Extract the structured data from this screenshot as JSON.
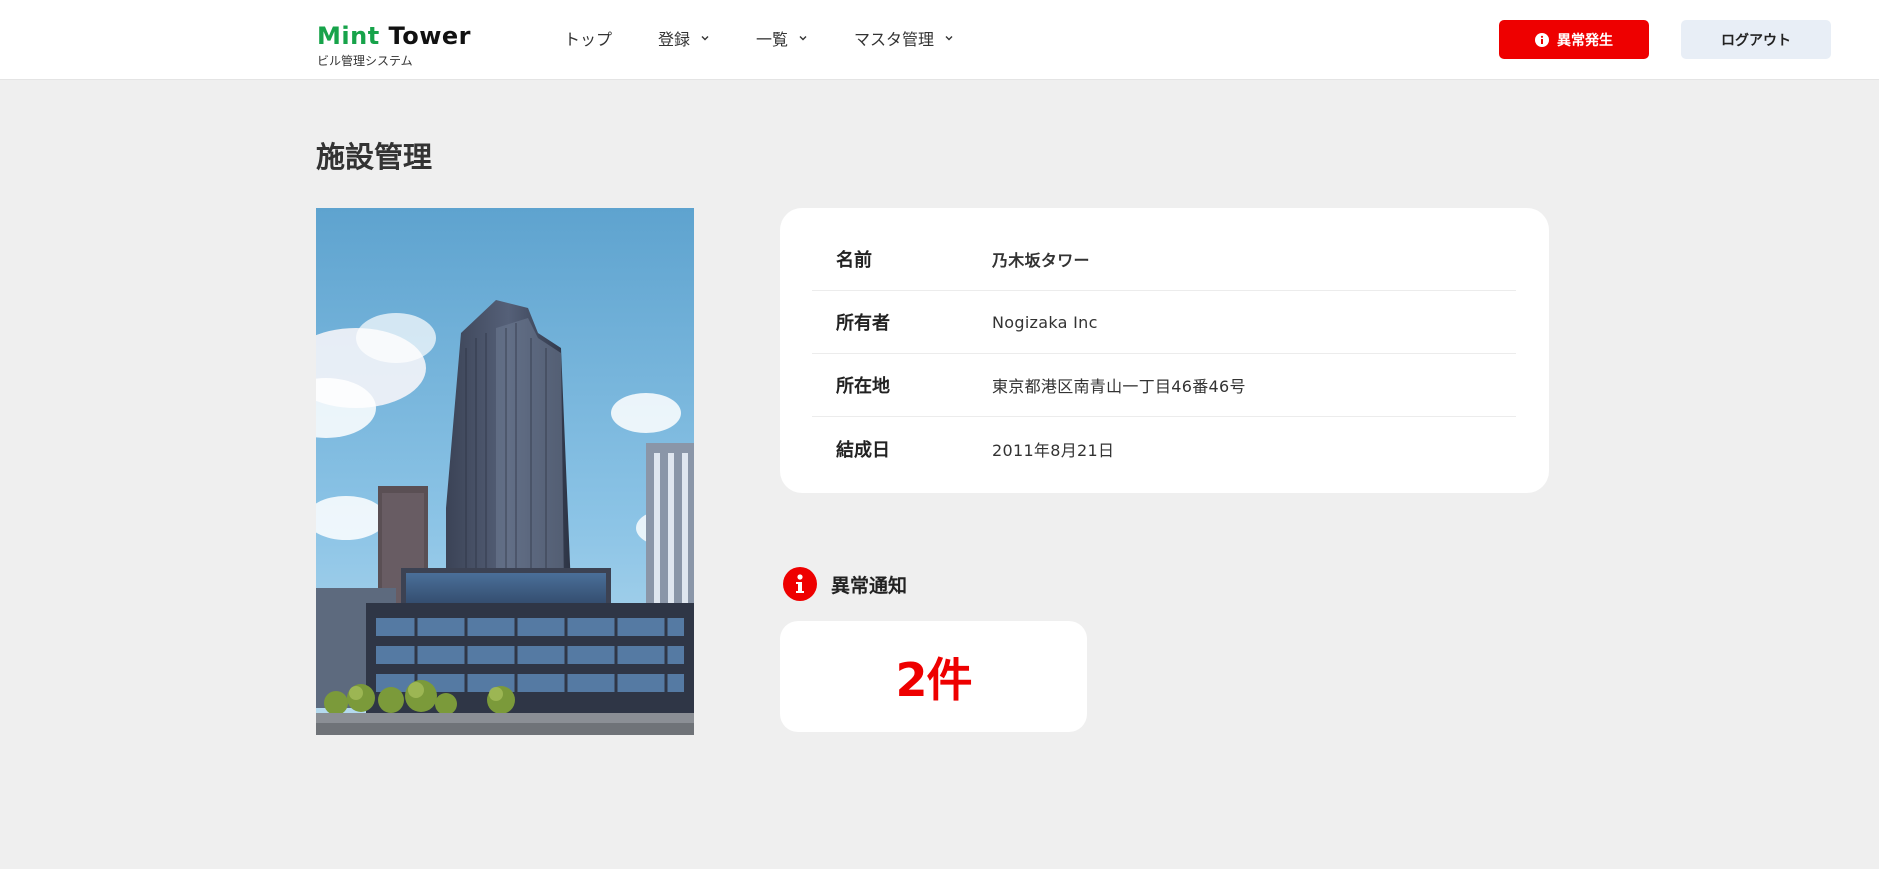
{
  "app": {
    "logo_first": "Mint",
    "logo_second": "Tower",
    "subtitle": "ビル管理システム"
  },
  "nav": {
    "items": [
      {
        "label": "トップ",
        "has_dropdown": false
      },
      {
        "label": "登録",
        "has_dropdown": true
      },
      {
        "label": "一覧",
        "has_dropdown": true
      },
      {
        "label": "マスタ管理",
        "has_dropdown": true
      }
    ]
  },
  "header": {
    "alert_button_label": "異常発生",
    "logout_button_label": "ログアウト"
  },
  "page": {
    "title": "施設管理"
  },
  "facility": {
    "rows": [
      {
        "label": "名前",
        "value": "乃木坂タワー"
      },
      {
        "label": "所有者",
        "value": "Nogizaka Inc"
      },
      {
        "label": "所在地",
        "value": "東京都港区南青山一丁目46番46号"
      },
      {
        "label": "結成日",
        "value": "2011年8月21日"
      }
    ]
  },
  "alerts": {
    "heading": "異常通知",
    "count_text": "2件"
  },
  "colors": {
    "brand_green": "#17a34a",
    "alert_red": "#ee0000",
    "logout_bg": "#e8eef6",
    "page_bg": "#efefef"
  }
}
